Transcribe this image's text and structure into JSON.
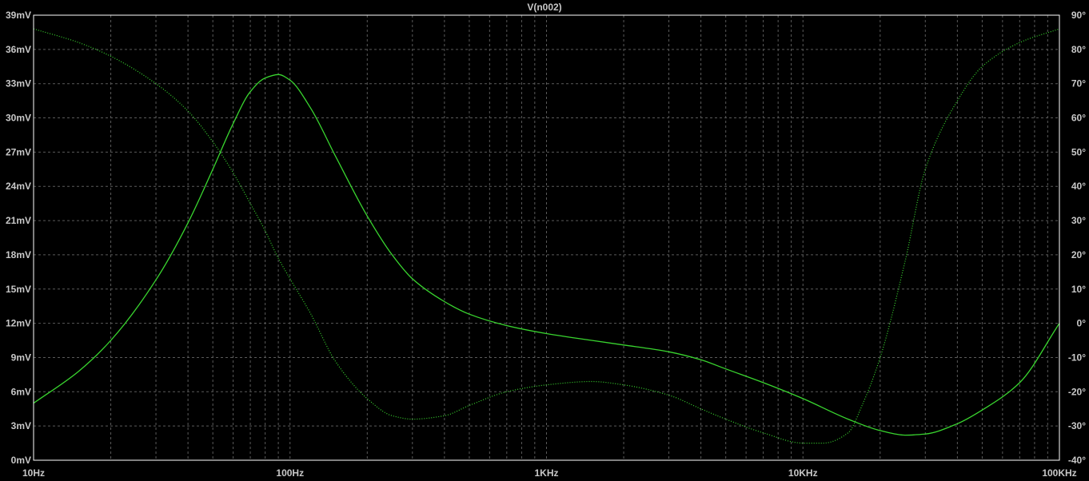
{
  "chart_data": {
    "type": "line",
    "title": "V(n002)",
    "colors": {
      "background": "#000000",
      "frame": "#ffffff",
      "grid": "#5a5a5a",
      "trace": "#39d52f",
      "title": "#39d52f",
      "tick_text": "#c8c8c8"
    },
    "grid": true,
    "x_axis": {
      "scale": "log",
      "range": [
        10,
        100000
      ],
      "ticks": [
        10,
        100,
        1000,
        10000,
        100000
      ],
      "tick_labels": [
        "10Hz",
        "100Hz",
        "1KHz",
        "10KHz",
        "100KHz"
      ]
    },
    "y_left": {
      "range": [
        0,
        39
      ],
      "ticks": [
        0,
        3,
        6,
        9,
        12,
        15,
        18,
        21,
        24,
        27,
        30,
        33,
        36,
        39
      ],
      "tick_labels": [
        "0mV",
        "3mV",
        "6mV",
        "9mV",
        "12mV",
        "15mV",
        "18mV",
        "21mV",
        "24mV",
        "27mV",
        "30mV",
        "33mV",
        "36mV",
        "39mV"
      ]
    },
    "y_right": {
      "range": [
        -40,
        90
      ],
      "ticks": [
        -40,
        -30,
        -20,
        -10,
        0,
        10,
        20,
        30,
        40,
        50,
        60,
        70,
        80,
        90
      ],
      "tick_labels": [
        "-40°",
        "-30°",
        "-20°",
        "-10°",
        "0°",
        "10°",
        "20°",
        "30°",
        "40°",
        "50°",
        "60°",
        "70°",
        "80°",
        "90°"
      ]
    },
    "series": [
      {
        "axis": "left",
        "style": "solid",
        "x": [
          10,
          15,
          20,
          30,
          40,
          50,
          60,
          70,
          80,
          90,
          100,
          120,
          150,
          200,
          250,
          300,
          400,
          500,
          700,
          1000,
          1500,
          2000,
          3000,
          4000,
          5000,
          7000,
          10000,
          15000,
          20000,
          25000,
          30000,
          40000,
          50000,
          70000,
          100000
        ],
        "y": [
          5.0,
          7.8,
          10.5,
          15.8,
          20.8,
          25.5,
          29.5,
          32.3,
          33.5,
          33.8,
          33.3,
          30.9,
          26.7,
          21.4,
          18.0,
          15.9,
          13.9,
          12.8,
          11.8,
          11.1,
          10.5,
          10.1,
          9.5,
          8.8,
          8.0,
          6.8,
          5.4,
          3.6,
          2.6,
          2.2,
          2.3,
          3.2,
          4.4,
          6.8,
          12.0
        ]
      },
      {
        "axis": "right",
        "style": "dotted",
        "x": [
          10,
          15,
          20,
          30,
          40,
          50,
          60,
          70,
          80,
          90,
          100,
          120,
          150,
          200,
          250,
          300,
          400,
          500,
          700,
          1000,
          1500,
          2000,
          3000,
          4000,
          5000,
          7000,
          10000,
          12000,
          15000,
          17000,
          20000,
          25000,
          30000,
          40000,
          50000,
          70000,
          100000
        ],
        "y": [
          86,
          82,
          78,
          70,
          62,
          53,
          44,
          35,
          27,
          19,
          13,
          3,
          -11,
          -22,
          -27,
          -28,
          -27,
          -24,
          -20,
          -18,
          -17,
          -18,
          -21,
          -25,
          -28,
          -32,
          -35,
          -35,
          -32,
          -24,
          -10,
          18,
          45,
          65,
          75,
          82,
          86
        ]
      }
    ]
  }
}
